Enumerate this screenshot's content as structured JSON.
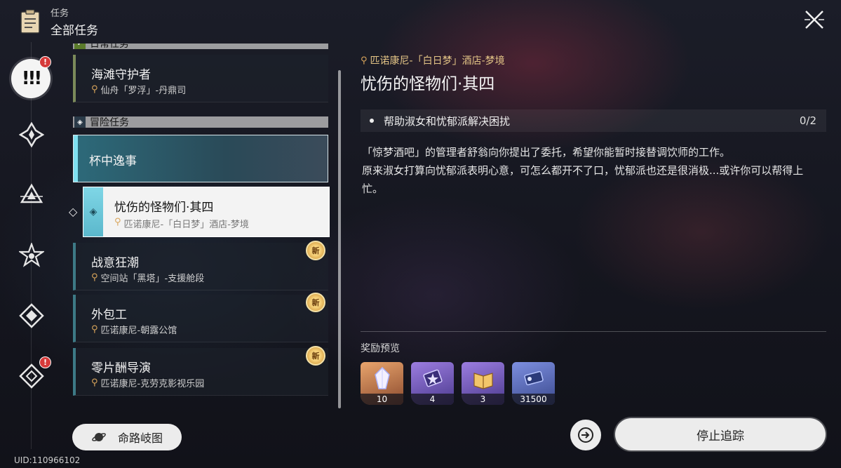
{
  "header": {
    "subtitle": "任务",
    "title": "全部任务"
  },
  "rail": {
    "badge_top": "!",
    "badge_bottom": "!"
  },
  "uid": "UID:110966102",
  "list": {
    "partial_category": "日常任务",
    "category_adventure": "冒险任务",
    "items": [
      {
        "title": "海滩守护者",
        "location": "仙舟「罗浮」-丹鼎司"
      },
      {
        "title": "杯中逸事"
      },
      {
        "title": "忧伤的怪物们·其四",
        "location": "匹诺康尼-「白日梦」酒店-梦境"
      },
      {
        "title": "战意狂潮",
        "location": "空间站「黑塔」-支援舱段",
        "badge": "新"
      },
      {
        "title": "外包工",
        "location": "匹诺康尼-朝露公馆",
        "badge": "新"
      },
      {
        "title": "零片酬导演",
        "location": "匹诺康尼-克劳克影视乐园",
        "badge": "新"
      }
    ]
  },
  "map_button": {
    "label": "命路岐图"
  },
  "detail": {
    "location": "匹诺康尼-「白日梦」酒店-梦境",
    "title": "忧伤的怪物们·其四",
    "objective": {
      "text": "帮助淑女和忧郁派解决困扰",
      "progress": "0/2"
    },
    "description_1": "「惊梦酒吧」的管理者舒翁向你提出了委托，希望你能暂时接替调饮师的工作。",
    "description_2": "原来淑女打算向忧郁派表明心意，可怎么都开不了口，忧郁派也还是很消极...或许你可以帮得上忙。",
    "reward_label": "奖励预览",
    "rewards": [
      {
        "count": "10",
        "icon": "crystal-icon"
      },
      {
        "count": "4",
        "icon": "battle-record-icon"
      },
      {
        "count": "3",
        "icon": "book-icon"
      },
      {
        "count": "31500",
        "icon": "credit-icon"
      }
    ]
  },
  "track_button": {
    "label": "停止追踪"
  }
}
